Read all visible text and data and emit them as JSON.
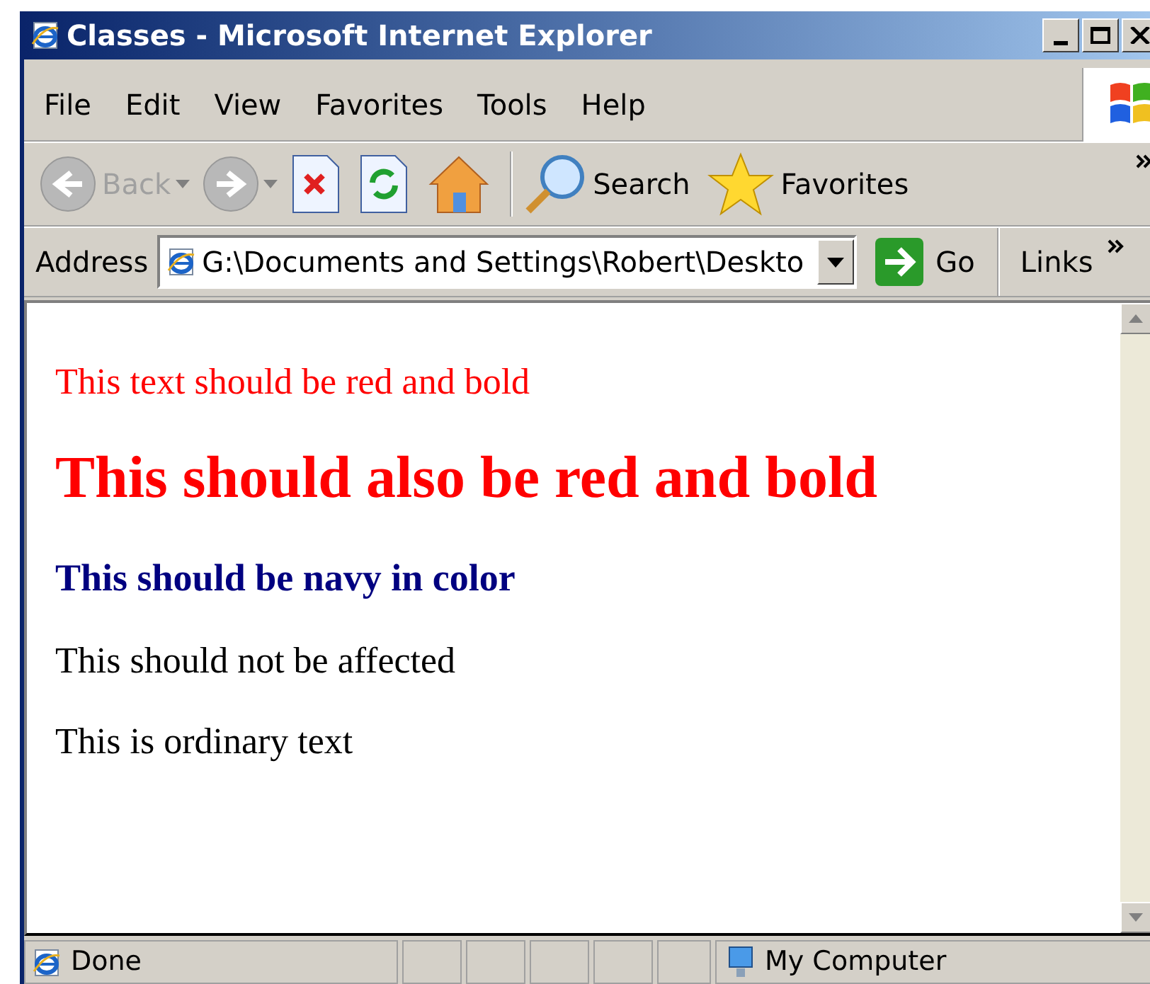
{
  "window": {
    "title": "Classes - Microsoft Internet Explorer"
  },
  "menu": [
    "File",
    "Edit",
    "View",
    "Favorites",
    "Tools",
    "Help"
  ],
  "toolbar": [
    {
      "kind": "back",
      "label": "Back",
      "disabled": true
    },
    {
      "kind": "forward",
      "disabled": true
    },
    {
      "kind": "stop"
    },
    {
      "kind": "refresh"
    },
    {
      "kind": "home"
    },
    {
      "kind": "search",
      "label": "Search"
    },
    {
      "kind": "favorites",
      "label": "Favorites"
    }
  ],
  "address": {
    "label": "Address",
    "value": "G:\\Documents and Settings\\Robert\\Deskto",
    "go": "Go",
    "links": "Links"
  },
  "content": [
    {
      "kind": "p",
      "text": "This text should be red and bold",
      "color": "#ff0000"
    },
    {
      "kind": "h1",
      "text": "This should also be red and bold",
      "color": "#ff0000"
    },
    {
      "kind": "h3",
      "text": "This should be navy in color",
      "color": "#000080"
    },
    {
      "kind": "p",
      "text": "This should not be affected",
      "color": "#000000"
    },
    {
      "kind": "p",
      "text": "This is ordinary text",
      "color": "#000000"
    }
  ],
  "status_bar": {
    "text": "Done",
    "zone": "My Computer"
  }
}
